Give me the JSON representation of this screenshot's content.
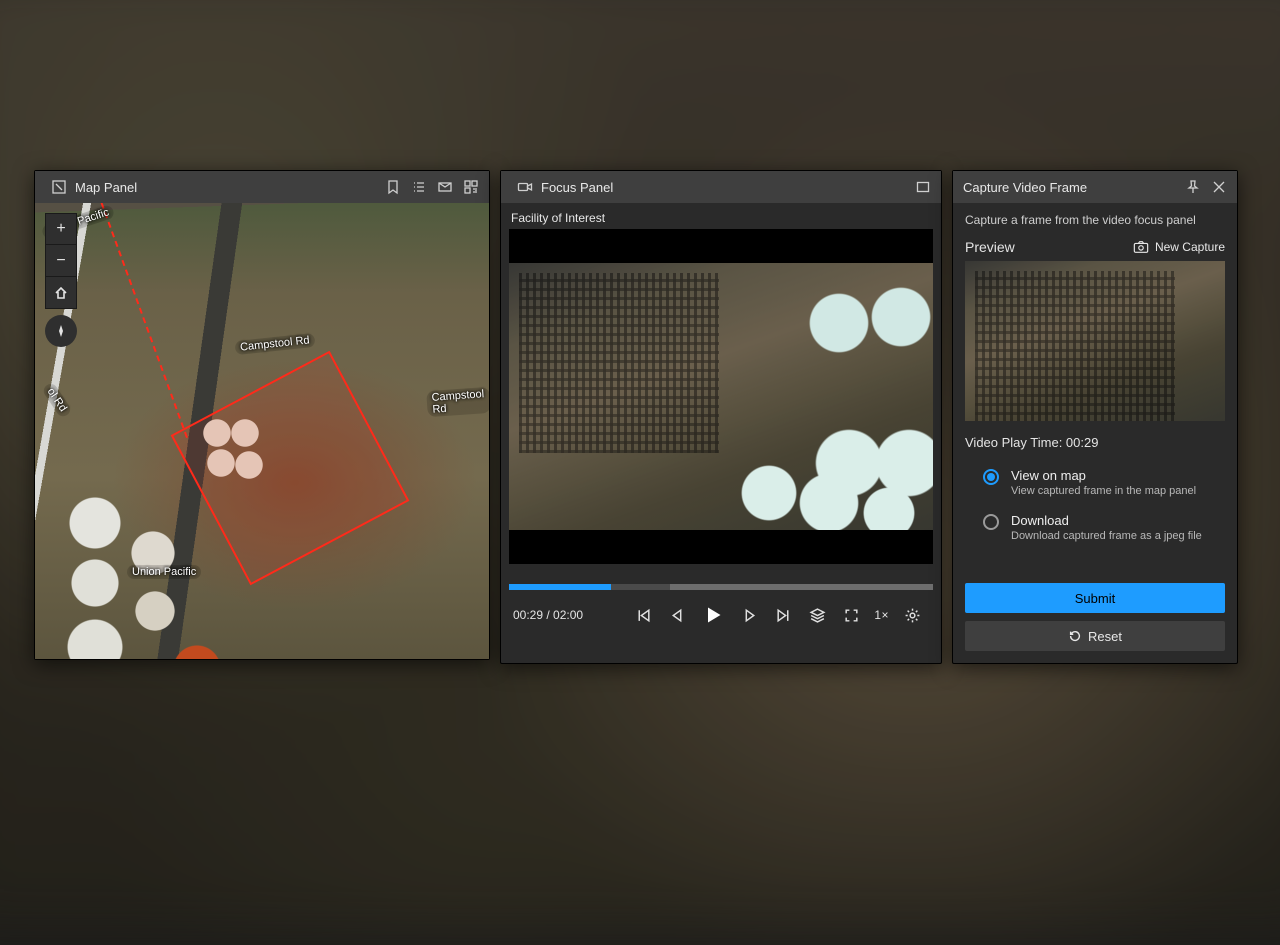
{
  "mapPanel": {
    "title": "Map Panel",
    "roads": {
      "campstool1": "Campstool Rd",
      "campstool2": "Campstool Rd",
      "ool": "ol Rd",
      "up": "Union Pacific",
      "up2": "Union Pacific"
    },
    "tools": {
      "zoomIn": "+",
      "zoomOut": "−"
    }
  },
  "focusPanel": {
    "title": "Focus Panel",
    "subtitle": "Facility of Interest",
    "progress": {
      "playedPct": 24,
      "bufferedStartPct": 38,
      "bufferedEndPct": 100
    },
    "time": {
      "current": "00:29",
      "total": "02:00",
      "display": "00:29 / 02:00"
    },
    "rate": "1×"
  },
  "capturePanel": {
    "title": "Capture Video Frame",
    "description": "Capture a frame from the video focus panel",
    "previewLabel": "Preview",
    "newCapture": "New Capture",
    "playTimeLabel": "Video Play Time: 00:29",
    "options": {
      "viewOnMap": {
        "title": "View on map",
        "desc": "View captured frame in the map panel",
        "checked": true
      },
      "download": {
        "title": "Download",
        "desc": "Download captured frame as a jpeg file",
        "checked": false
      }
    },
    "submit": "Submit",
    "reset": "Reset"
  }
}
